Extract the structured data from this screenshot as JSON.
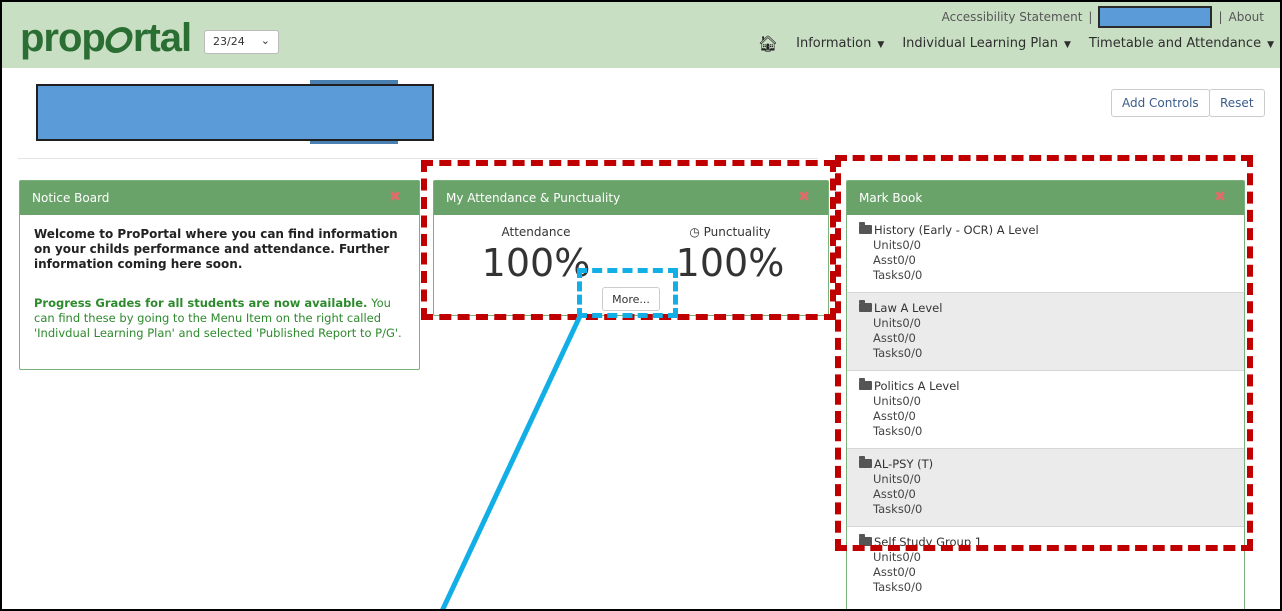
{
  "header": {
    "logo_text_1": "prop",
    "logo_text_2": "rtal",
    "year_value": "23/24",
    "top_links": {
      "accessibility": "Accessibility Statement",
      "sep1": "|",
      "sep2": "|",
      "about": "About"
    },
    "nav": [
      {
        "label": "Information"
      },
      {
        "label": "Individual Learning Plan"
      },
      {
        "label": "Timetable and Attendance"
      }
    ],
    "home_icon": "home-icon"
  },
  "toolbar": {
    "add_controls": "Add Controls",
    "reset": "Reset"
  },
  "notice_board": {
    "title": "Notice Board",
    "welcome": "Welcome to ProPortal where you can find information on your childs performance and attendance. Further information coming here soon.",
    "progress_bold": "Progress Grades for all students are now available.",
    "progress_rest": " You can find these by going to the Menu Item on the right called 'Indivdual Learning Plan' and selected 'Published Report to P/G'."
  },
  "attendance": {
    "title": "My Attendance & Punctuality",
    "attendance_label": "Attendance",
    "attendance_value": "100%",
    "punctuality_label": "Punctuality",
    "punctuality_value": "100%",
    "more_label": "More..."
  },
  "mark_book": {
    "title": "Mark Book",
    "items": [
      {
        "name": "History (Early - OCR) A Level",
        "units": "Units0/0",
        "asst": "Asst0/0",
        "tasks": "Tasks0/0"
      },
      {
        "name": "Law A Level",
        "units": "Units0/0",
        "asst": "Asst0/0",
        "tasks": "Tasks0/0"
      },
      {
        "name": "Politics A Level",
        "units": "Units0/0",
        "asst": "Asst0/0",
        "tasks": "Tasks0/0"
      },
      {
        "name": "AL-PSY (T)",
        "units": "Units0/0",
        "asst": "Asst0/0",
        "tasks": "Tasks0/0"
      },
      {
        "name": "Self Study Group 1",
        "units": "Units0/0",
        "asst": "Asst0/0",
        "tasks": "Tasks0/0"
      }
    ]
  },
  "colors": {
    "brand_green": "#2b6e33",
    "panel_head": "#6aa36a",
    "header_bg": "#c9dfc4",
    "annotation_red": "#c00000",
    "annotation_blue": "#12aee6",
    "redaction": "#5a9bd8"
  }
}
